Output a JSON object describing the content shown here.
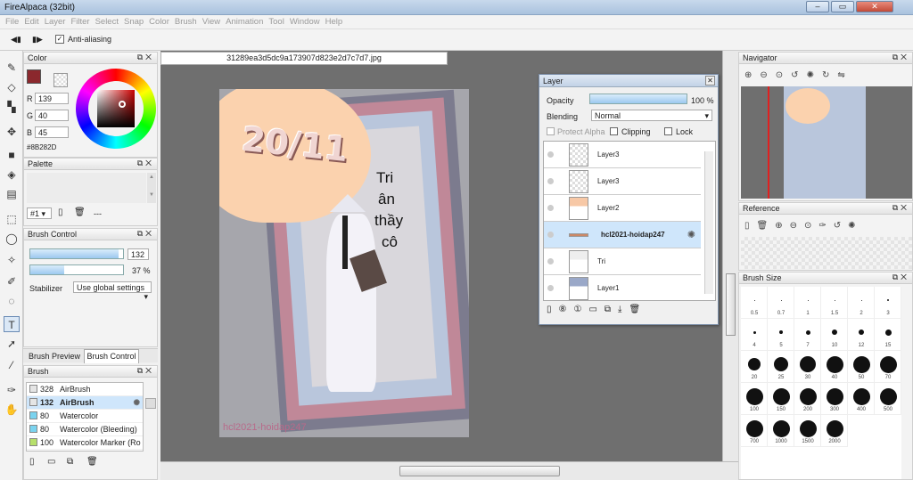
{
  "window": {
    "title": "FireAlpaca (32bit)",
    "min": "0",
    "max": "1",
    "close": "r"
  },
  "menu": [
    "File",
    "Edit",
    "Layer",
    "Filter",
    "Select",
    "Snap",
    "Color",
    "Brush",
    "View",
    "Animation",
    "Tool",
    "Window",
    "Help"
  ],
  "options": {
    "antialiasing": "Anti-aliasing"
  },
  "color_panel": {
    "title": "Color",
    "r_label": "R",
    "r": "139",
    "g_label": "G",
    "g": "40",
    "b_label": "B",
    "b": "45",
    "hex": "#8B282D",
    "swatch": "#8B282D"
  },
  "palette_panel": {
    "title": "Palette",
    "preset": "#1",
    "dash": "---"
  },
  "brush_control": {
    "title": "Brush Control",
    "size": "132",
    "opacity": "37 %",
    "stabilizer_label": "Stabilizer",
    "stabilizer": "Use global settings",
    "size_fill": 0.95,
    "opacity_fill": 0.37
  },
  "brush_tabs": {
    "preview": "Brush Preview",
    "control": "Brush Control"
  },
  "brush_panel": {
    "title": "Brush",
    "items": [
      {
        "size": "328",
        "name": "AirBrush"
      },
      {
        "size": "132",
        "name": "AirBrush"
      },
      {
        "size": "80",
        "name": "Watercolor"
      },
      {
        "size": "80",
        "name": "Watercolor (Bleeding)"
      },
      {
        "size": "100",
        "name": "Watercolor Marker (Ro"
      }
    ]
  },
  "document": {
    "tab": "31289ea3d5dc9a173907d823e2d7c7d7.jpg",
    "art_title": "20/11",
    "art_text1": "Tri",
    "art_text2": "ân",
    "art_text3": "thầy",
    "art_text4": "cô",
    "watermark": "hcl2021-hoidap247"
  },
  "layer_panel": {
    "title": "Layer",
    "opacity_label": "Opacity",
    "opacity": "100 %",
    "blending_label": "Blending",
    "blending": "Normal",
    "protect_alpha": "Protect Alpha",
    "clipping": "Clipping",
    "lock": "Lock",
    "layers": [
      "Layer3",
      "Layer3",
      "Layer2",
      "hcl2021-hoidap247",
      "Tri",
      "Layer1"
    ]
  },
  "navigator": {
    "title": "Navigator"
  },
  "reference": {
    "title": "Reference"
  },
  "brush_size": {
    "title": "Brush Size",
    "sizes": [
      "0.5",
      "0.7",
      "1",
      "1.5",
      "2",
      "3",
      "4",
      "5",
      "7",
      "10",
      "12",
      "15",
      "20",
      "25",
      "30",
      "40",
      "50",
      "70",
      "100",
      "150",
      "200",
      "300",
      "400",
      "500",
      "700",
      "1000",
      "1500",
      "2000"
    ]
  }
}
